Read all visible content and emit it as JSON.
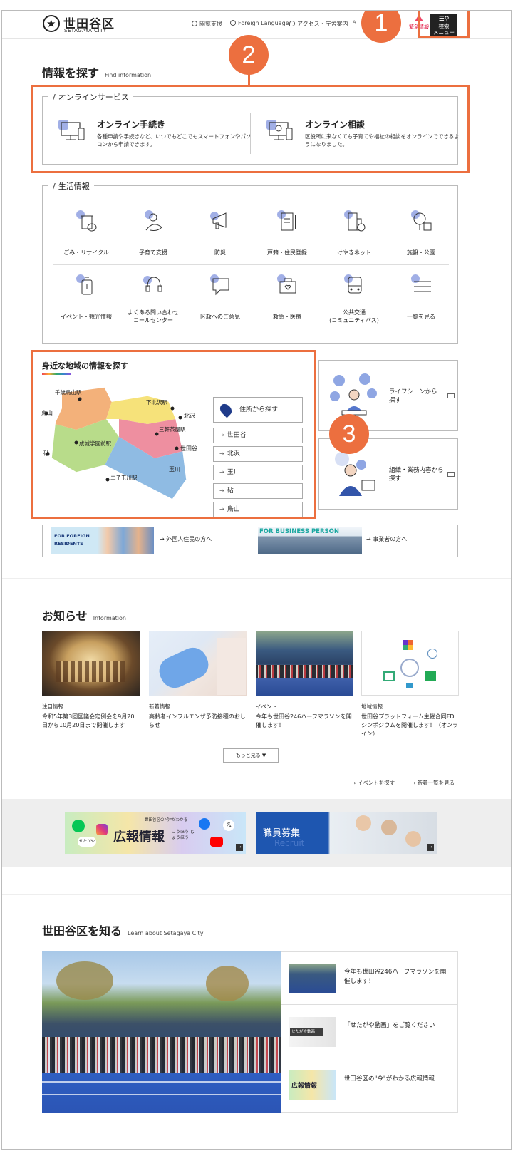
{
  "header": {
    "logo_jp": "世田谷区",
    "logo_en": "SETAGAYA CITY",
    "nav": [
      "閲覧支援",
      "Foreign Language",
      "アクセス・庁舎案内"
    ],
    "emergency": "緊急情報",
    "menu_label_1": "検索",
    "menu_label_2": "メニュー"
  },
  "callouts": [
    "1",
    "2",
    "3"
  ],
  "find": {
    "title": "情報を探す",
    "sub": "Find information"
  },
  "online": {
    "legend": "オンラインサービス",
    "items": [
      {
        "title": "オンライン手続き",
        "desc": "各種申請や手続きなど、いつでもどこでもスマートフォンやパソコンから申請できます。"
      },
      {
        "title": "オンライン相談",
        "desc": "区役所に来なくても子育てや福祉の相談をオンラインでできるようになりました。"
      }
    ]
  },
  "life": {
    "legend": "生活情報",
    "items": [
      {
        "label": "ごみ・リサイクル",
        "icon": "trash-icon"
      },
      {
        "label": "子育て支援",
        "icon": "baby-icon"
      },
      {
        "label": "防災",
        "icon": "megaphone-icon"
      },
      {
        "label": "戸籍・住民登録",
        "icon": "document-pen-icon"
      },
      {
        "label": "けやきネット",
        "icon": "building-clock-icon"
      },
      {
        "label": "施設・公園",
        "icon": "tree-icon"
      },
      {
        "label": "イベント・観光情報",
        "icon": "luggage-icon"
      },
      {
        "label": "よくある問い合わせ",
        "label2": "コールセンター",
        "icon": "headset-icon"
      },
      {
        "label": "区政へのご意見",
        "icon": "speech-bubble-icon"
      },
      {
        "label": "救急・医療",
        "icon": "medical-box-icon"
      },
      {
        "label": "公共交通",
        "label2": "(コミュニティバス)",
        "icon": "bus-icon"
      },
      {
        "label": "一覧を見る",
        "icon": "list-icon"
      }
    ]
  },
  "area": {
    "title": "身近な地域の情報を探す",
    "map_labels": [
      "千歳烏山駅",
      "烏山",
      "下北沢駅",
      "北沢",
      "三軒茶屋駅",
      "世田谷",
      "成城学園前駅",
      "砧",
      "玉川",
      "二子玉川駅"
    ],
    "address_search": "住所から探す",
    "districts": [
      "世田谷",
      "北沢",
      "玉川",
      "砧",
      "烏山"
    ]
  },
  "side_cards": [
    {
      "line1": "ライフシーンから",
      "line2": "探す"
    },
    {
      "line1": "組織・業務内容から",
      "line2": "探す"
    }
  ],
  "banners": [
    {
      "img_text_1": "FOR FOREIGN",
      "img_text_2": "RESIDENTS",
      "link": "外国人住民の方へ"
    },
    {
      "img_text_1": "FOR BUSINESS PERSON",
      "link": "事業者の方へ"
    }
  ],
  "news": {
    "title": "お知らせ",
    "sub": "Information",
    "items": [
      {
        "category": "注目情報",
        "title": "令和5年第3回区議会定例会を9月20日から10月20日まで開催します"
      },
      {
        "category": "新着情報",
        "title": "高齢者インフルエンザ予防接種のおしらせ"
      },
      {
        "category": "イベント",
        "title": "今年も世田谷246ハーフマラソンを開催します！"
      },
      {
        "category": "地域情報",
        "title": "世田谷プラットフォーム主催合同FDシンポジウムを開催します！（オンライン）"
      }
    ],
    "more": "もっと見る",
    "event_link": "イベントを探す",
    "new_link": "新着一覧を見る"
  },
  "promo": {
    "kouhou_title": "広報情報",
    "kouhou_ruby": "こうほう じょうほう",
    "kouhou_small": "世田谷区の\"今\"がわかる",
    "setagaya": "せたがや",
    "recruit_title": "職員募集",
    "recruit_en": "Recruit"
  },
  "learn": {
    "title": "世田谷区を知る",
    "sub": "Learn about Setagaya City",
    "items": [
      {
        "text": "今年も世田谷246ハーフマラソンを開催します！"
      },
      {
        "text": "「せたがや動画」をご覧ください",
        "thumb_text": "せたがや動画"
      },
      {
        "text": "世田谷区の\"今\"がわかる広報情報",
        "thumb_text": "広報情報"
      }
    ]
  },
  "colors": {
    "accent": "#ec6f3f",
    "icon_blob": "#8a9be0",
    "header_btn": "#222222"
  }
}
